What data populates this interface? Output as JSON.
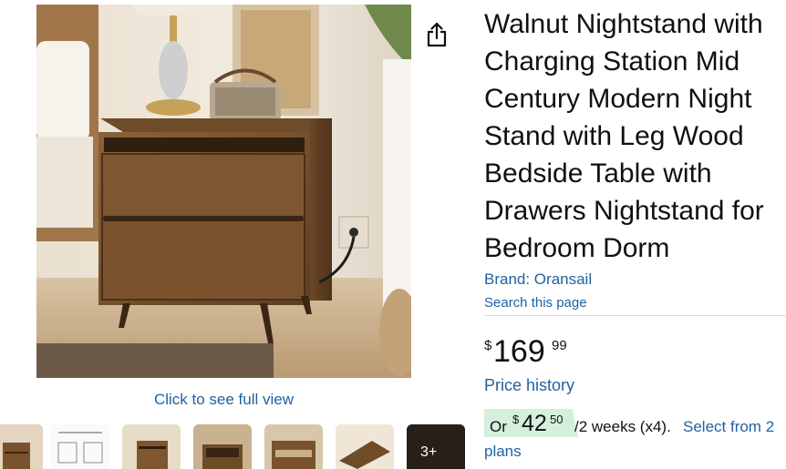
{
  "product": {
    "title": "Walnut Nightstand with Charging Station Mid Century Modern Night Stand with Leg Wood Bedside Table with Drawers Nightstand for Bedroom Dorm",
    "title_lines": [
      "Walnut Nightstand with",
      "Charging Station Mid",
      "Century Modern Night",
      "Stand with Leg Wood",
      "Bedside Table with",
      "Drawers Nightstand for",
      "Bedroom Dorm"
    ],
    "brand_label": "Brand: Oransail",
    "search_page_label": "Search this page"
  },
  "gallery": {
    "full_view_label": "Click to see full view",
    "more_thumbs_label": "3+",
    "selected_index": 0,
    "thumbnail_count": 7
  },
  "price": {
    "currency_symbol": "$",
    "whole": "169",
    "fraction": "99",
    "history_label": "Price history"
  },
  "installment": {
    "prefix": "Or",
    "currency_symbol": "$",
    "whole": "42",
    "fraction": "50",
    "period_text": "/2 weeks (x4).",
    "select_label": "Select from 2",
    "plans_label": "plans"
  },
  "icons": {
    "share": "share-icon"
  },
  "colors": {
    "link": "#2162a1",
    "text": "#0f1111",
    "installment_badge": "#d4f0dc",
    "selected_thumb_border": "#007185"
  }
}
